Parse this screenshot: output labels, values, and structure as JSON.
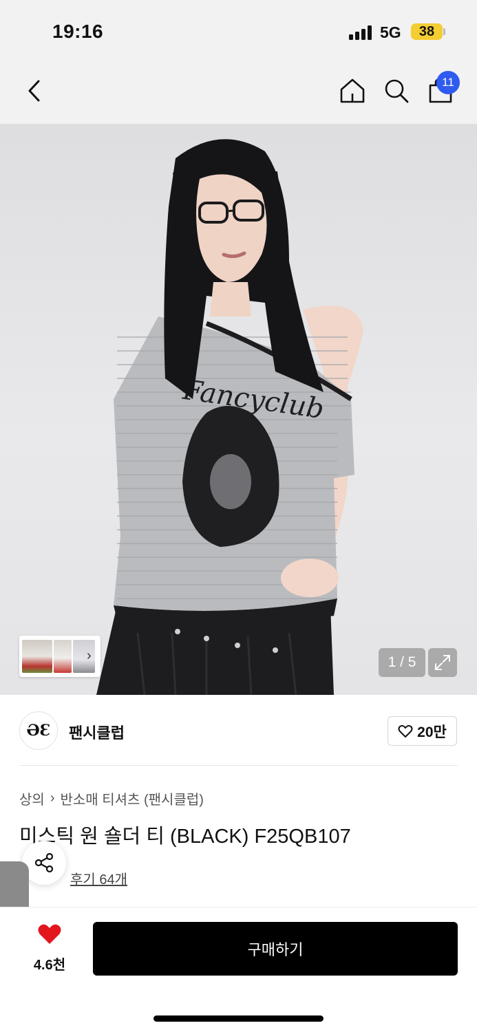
{
  "status_bar": {
    "time": "19:16",
    "network": "5G",
    "battery": "38"
  },
  "nav": {
    "cart_count": "11",
    "icons": [
      "back-icon",
      "home-icon",
      "search-icon",
      "cart-icon"
    ]
  },
  "gallery": {
    "page": "1 / 5",
    "thumbnails": 3
  },
  "brand": {
    "name": "팬시클럽",
    "logo_text": "ƏƐ",
    "likes": "20만"
  },
  "breadcrumb": {
    "category": "상의",
    "subcategory": "반소매 티셔츠 (팬시클럽)"
  },
  "product": {
    "title": "미스틱 원 숄더 티 (BLACK) F25QB107",
    "review_link": "후기 64개"
  },
  "bottom": {
    "like_count": "4.6천",
    "buy_label": "구매하기"
  },
  "colors": {
    "accent_blue": "#2f5bf0",
    "heart_red": "#e3161e",
    "buy_bg": "#000000"
  }
}
